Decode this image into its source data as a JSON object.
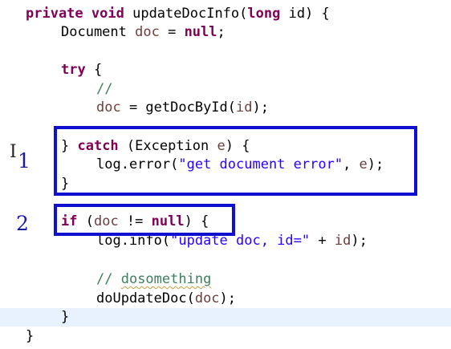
{
  "code": {
    "l1": {
      "kw1": "private",
      "kw2": "void",
      "rest": " updateDocInfo(",
      "kw3": "long",
      "rest2": " id) {"
    },
    "l2": {
      "a": "Document ",
      "var": "doc",
      "b": " = ",
      "kw": "null",
      "c": ";"
    },
    "l3": {
      "kw": "try",
      "b": " {"
    },
    "l4": {
      "cmt": "//"
    },
    "l5": {
      "var": "doc",
      "b": " = getDocById(",
      "var2": "id",
      "c": ");"
    },
    "l6": {
      "a": "} ",
      "kw": "catch",
      "b": " (Exception ",
      "var": "e",
      "c": ") {"
    },
    "l7": {
      "a": "log.error(",
      "str": "\"get document error\"",
      "b": ", ",
      "var": "e",
      "c": ");"
    },
    "l8": {
      "a": "}"
    },
    "l9": {
      "kw": "if",
      "b": " (",
      "var": "doc",
      "c": " != ",
      "kw2": "null",
      "d": ") {"
    },
    "l10": {
      "a": "log.info(",
      "str": "\"update doc, id=\"",
      "b": " + ",
      "var": "id",
      "c": ");"
    },
    "l11": {
      "cmt1": "// ",
      "cmt2": "dosomething"
    },
    "l12": {
      "a": "doUpdateDoc(",
      "var": "doc",
      "c": ");"
    },
    "l13": {
      "a": "}"
    },
    "l14": {
      "a": "}"
    }
  },
  "annotations": {
    "marker1": "1",
    "marker2": "2",
    "cursor": "I"
  },
  "colors": {
    "keyword": "#7f0055",
    "variable": "#6a3e3e",
    "string": "#2a00ff",
    "comment": "#3f7f5f",
    "annotation_box": "#1010d0",
    "current_line": "#e8f2fe"
  }
}
